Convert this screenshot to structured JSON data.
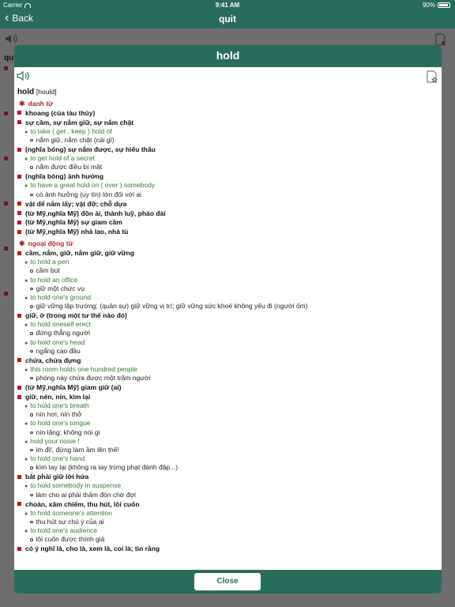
{
  "status": {
    "carrier": "Carrier",
    "time": "9:41 AM",
    "battery": "90%"
  },
  "nav": {
    "back_label": "Back",
    "title": "quit"
  },
  "background": {
    "word": "qu"
  },
  "modal": {
    "title": "hold",
    "headword": "hold",
    "phonetic": "[hould]",
    "close_label": "Close",
    "sections": [
      {
        "pos": "danh từ",
        "senses": [
          {
            "meaning": "khoang (của tàu thủy)",
            "examples": []
          },
          {
            "meaning": "sự cầm, sự nắm giữ, sự nắm chặt",
            "examples": [
              {
                "en": "to take ( get , keep ) hold of",
                "vi": "nắm giữ, nắm chặt (cái gì)"
              }
            ]
          },
          {
            "meaning": "(nghĩa bóng) sự nắm được, sự hiểu thấu",
            "examples": [
              {
                "en": "to get hold of a secret",
                "vi": "nắm được điều bí mật"
              }
            ]
          },
          {
            "meaning": "(nghĩa bóng) ảnh hưởng",
            "examples": [
              {
                "en": "to have a great hold on ( over ) somebody",
                "vi": "có ảnh hưởng (uy tín) lớn đối với ai"
              }
            ]
          },
          {
            "meaning": "vật để nắm lấy; vật đỡ; chỗ dựa",
            "examples": []
          },
          {
            "meaning": "(từ Mỹ,nghĩa Mỹ) đồn ải, thành luỹ, pháo đài",
            "examples": []
          },
          {
            "meaning": "(từ Mỹ,nghĩa Mỹ) sự giam cầm",
            "examples": []
          },
          {
            "meaning": "(từ Mỹ,nghĩa Mỹ) nhà lao, nhà tù",
            "examples": []
          }
        ]
      },
      {
        "pos": "ngoại động từ",
        "senses": [
          {
            "meaning": "cầm, nắm, giữ, nắm giữ, giữ vững",
            "examples": [
              {
                "en": "to hold a pen",
                "vi": "cầm bút"
              },
              {
                "en": "to hold an office",
                "vi": "giữ một chức vụ"
              },
              {
                "en": "to hold one's ground",
                "vi": "giữ vững lập trường; (quân sự) giữ vững vị trí; giữ vững sức khoẻ không yếu đi (người ốm)"
              }
            ]
          },
          {
            "meaning": "giữ, ở (trong một tư thế nào đó)",
            "examples": [
              {
                "en": "to hold oneself erect",
                "vi": "đứng thẳng người"
              },
              {
                "en": "to hold one's head",
                "vi": "ngẩng cao đầu"
              }
            ]
          },
          {
            "meaning": "chứa, chứa đựng",
            "examples": [
              {
                "en": "this room holds one hundred people",
                "vi": "phòng này chứa được một trăm người"
              }
            ]
          },
          {
            "meaning": "(từ Mỹ,nghĩa Mỹ) giam giữ (ai)",
            "examples": []
          },
          {
            "meaning": "giữ, nén, nín, kìm lại",
            "examples": [
              {
                "en": "to hold one's breath",
                "vi": "nín hơi, nín thở"
              },
              {
                "en": "to hold one's tongue",
                "vi": "nín lặng; không nói gì"
              },
              {
                "en": "hold your noise !",
                "vi": "im đi!, đừng làm ầm lên thế!"
              },
              {
                "en": "to hold one's hand",
                "vi": "kìm tay lại (không ra tay trừng phạt đánh đập...)"
              }
            ]
          },
          {
            "meaning": "bắt phải giữ lời hứa",
            "examples": [
              {
                "en": "to hold somebody in suspense",
                "vi": "làm cho ai phải thấm đòn chờ đợi"
              }
            ]
          },
          {
            "meaning": "choán, xâm chiếm, thu hút, lôi cuốn",
            "examples": [
              {
                "en": "to hold someone's attention",
                "vi": "thu hút sự chú ý của ai"
              },
              {
                "en": "to hold one's audience",
                "vi": "lôi cuốn được thính giả"
              }
            ]
          },
          {
            "meaning": "có ý nghĩ là, cho là, xem là, coi là; tin rằng",
            "examples": []
          }
        ]
      }
    ]
  }
}
